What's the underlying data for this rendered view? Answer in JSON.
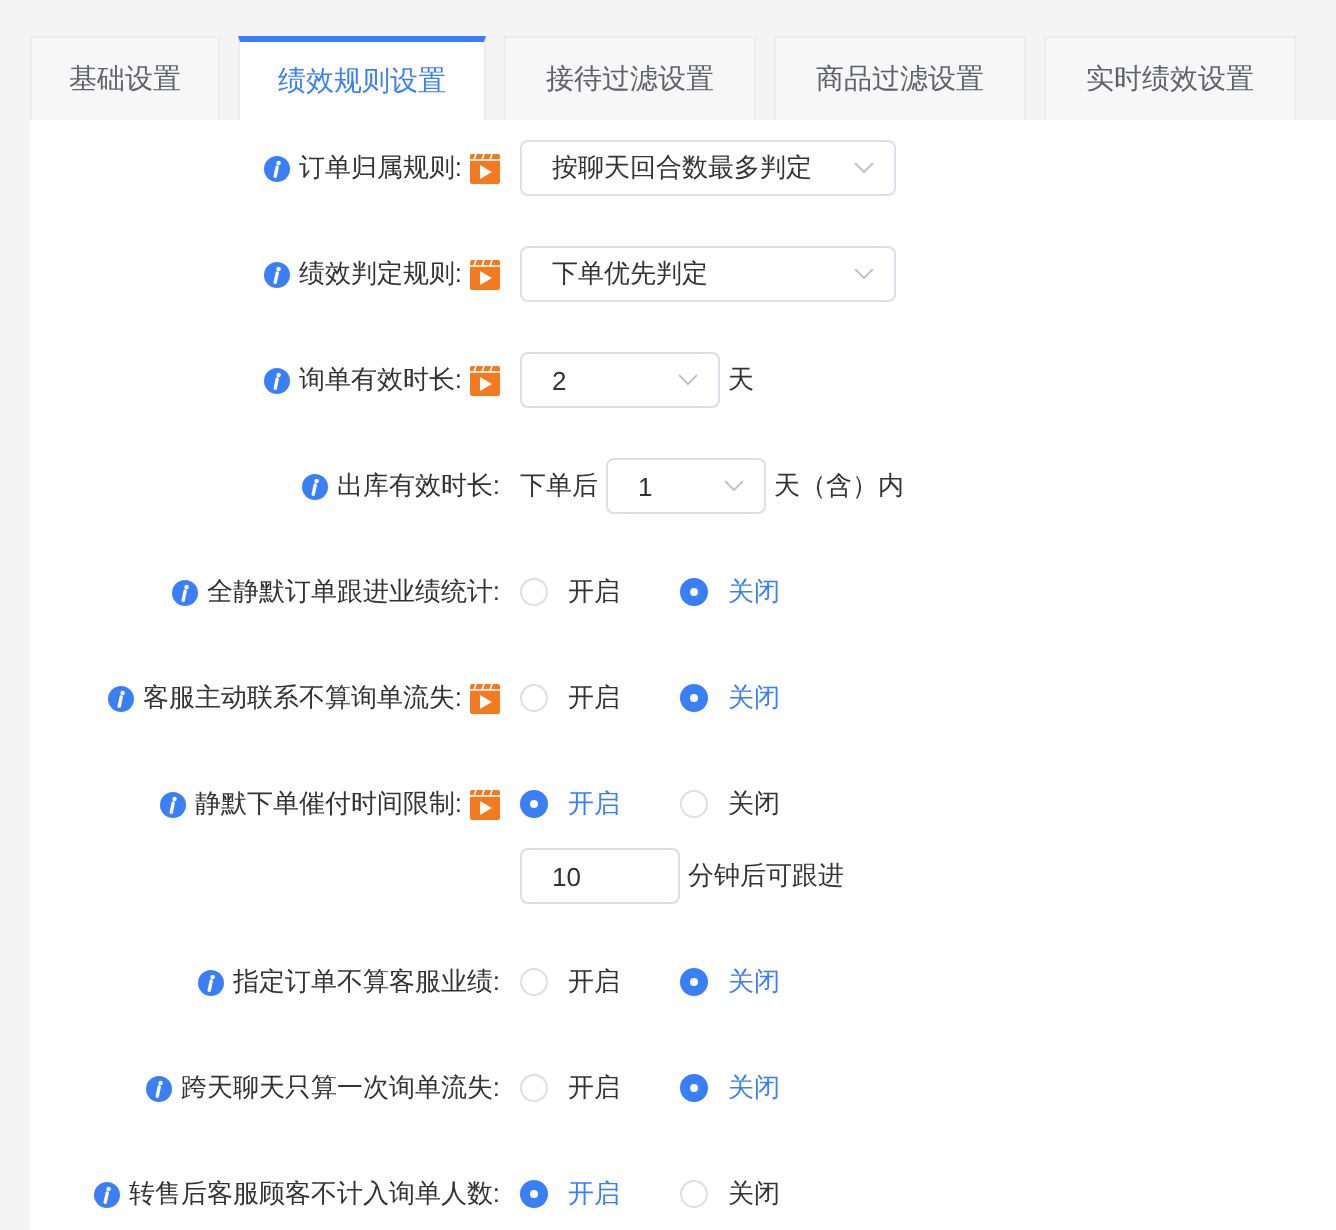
{
  "tabs": [
    {
      "label": "基础设置",
      "selected": false
    },
    {
      "label": "绩效规则设置",
      "selected": true
    },
    {
      "label": "接待过滤设置",
      "selected": false
    },
    {
      "label": "商品过滤设置",
      "selected": false
    },
    {
      "label": "实时绩效设置",
      "selected": false
    }
  ],
  "rows": [
    {
      "kind": "select",
      "label": "订单归属规则:",
      "video": true,
      "value": "按聊天回合数最多判定"
    },
    {
      "kind": "select",
      "label": "绩效判定规则:",
      "video": true,
      "value": "下单优先判定"
    },
    {
      "kind": "select",
      "label": "询单有效时长:",
      "video": true,
      "value": "2",
      "suffix": "天"
    },
    {
      "kind": "select",
      "label": "出库有效时长:",
      "video": false,
      "prefix": "下单后",
      "value": "1",
      "suffix": "天（含）内"
    },
    {
      "kind": "radio",
      "label": "全静默订单跟进业绩统计:",
      "video": false,
      "options": [
        {
          "label": "开启",
          "selected": false
        },
        {
          "label": "关闭",
          "selected": true
        }
      ]
    },
    {
      "kind": "radio",
      "label": "客服主动联系不算询单流失:",
      "video": true,
      "options": [
        {
          "label": "开启",
          "selected": false
        },
        {
          "label": "关闭",
          "selected": true
        }
      ]
    },
    {
      "kind": "radio",
      "label": "静默下单催付时间限制:",
      "video": true,
      "options": [
        {
          "label": "开启",
          "selected": true
        },
        {
          "label": "关闭",
          "selected": false
        }
      ],
      "extra": {
        "value": "10",
        "suffix": "分钟后可跟进"
      }
    },
    {
      "kind": "radio",
      "label": "指定订单不算客服业绩:",
      "video": false,
      "options": [
        {
          "label": "开启",
          "selected": false
        },
        {
          "label": "关闭",
          "selected": true
        }
      ]
    },
    {
      "kind": "radio",
      "label": "跨天聊天只算一次询单流失:",
      "video": false,
      "options": [
        {
          "label": "开启",
          "selected": false
        },
        {
          "label": "关闭",
          "selected": true
        }
      ]
    },
    {
      "kind": "radio",
      "label": "转售后客服顾客不计入询单人数:",
      "video": false,
      "options": [
        {
          "label": "开启",
          "selected": true
        },
        {
          "label": "关闭",
          "selected": false
        }
      ]
    }
  ]
}
